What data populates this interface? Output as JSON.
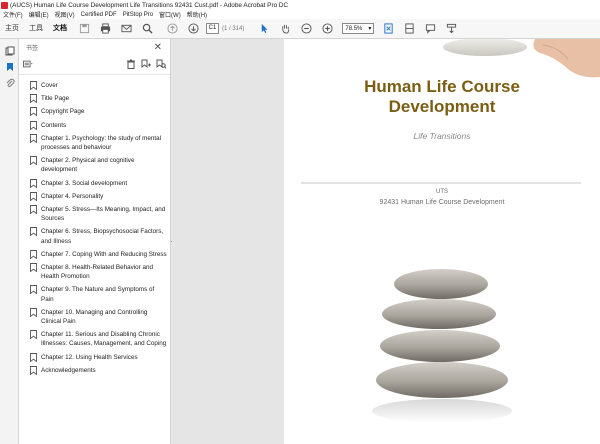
{
  "window": {
    "title": "(AUCS) Human Life Course Development Life Transitions 92431 Cust.pdf - Adobe Acrobat Pro DC"
  },
  "menubar": [
    "文件(F)",
    "编辑(E)",
    "视图(V)",
    "Certified PDF",
    "PitStop Pro",
    "窗口(W)",
    "帮助(H)"
  ],
  "toolbar": {
    "tabs": [
      "主页",
      "工具",
      "文档"
    ],
    "page_current": "C1",
    "page_total": "(1 / 314)",
    "zoom": "78.5%"
  },
  "bookmarks": {
    "title": "书签",
    "items": [
      "Cover",
      "Title Page",
      "Copyright Page",
      "Contents",
      "Chapter 1. Psychology: the study of mental processes and behaviour",
      "Chapter 2. Physical and cognitive development",
      "Chapter 3. Social development",
      "Chapter 4. Personality",
      "Chapter 5. Stress—Its Meaning, Impact, and Sources",
      "Chapter 6. Stress, Biopsychosocial Factors, and Illness",
      "Chapter 7. Coping With and Reducing Stress",
      "Chapter 8. Health-Related Behavior and Health Promotion",
      "Chapter 9. The Nature and Symptoms of Pain",
      "Chapter 10. Managing and Controlling Clinical Pain",
      "Chapter 11. Serious and Disabling Chronic Illnesses: Causes, Management, and Coping",
      "Chapter 12. Using Health Services",
      "Acknowledgements"
    ]
  },
  "document": {
    "title_line1": "Human Life Course",
    "title_line2": "Development",
    "subtitle": "Life Transitions",
    "institution": "UTS",
    "course": "92431 Human Life Course Development"
  },
  "colors": {
    "title_brown": "#7a5e14",
    "acrobat_red": "#d9262c",
    "select_blue": "#1a73c8"
  }
}
